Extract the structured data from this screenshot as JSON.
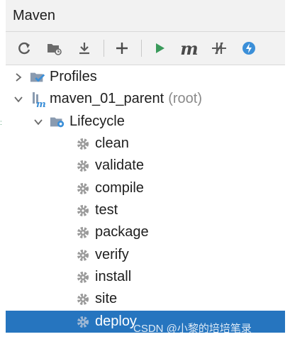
{
  "panel": {
    "title": "Maven"
  },
  "toolbar": {
    "buttons": [
      {
        "icon": "reload-icon"
      },
      {
        "icon": "generate-sources-icon"
      },
      {
        "icon": "download-icon"
      },
      {
        "icon": "add-icon"
      },
      {
        "icon": "run-icon"
      },
      {
        "icon": "execute-goal-icon",
        "label": "m"
      },
      {
        "icon": "skip-tests-icon"
      },
      {
        "icon": "offline-icon"
      }
    ]
  },
  "tree": {
    "profiles_label": "Profiles",
    "project_label": "maven_01_parent",
    "project_suffix": "(root)",
    "lifecycle_label": "Lifecycle",
    "goals": [
      "clean",
      "validate",
      "compile",
      "test",
      "package",
      "verify",
      "install",
      "site",
      "deploy"
    ],
    "selected_goal": "deploy"
  },
  "watermark": "CSDN @小黎的培培笔录",
  "colors": {
    "selection": "#2675bf",
    "run_green": "#3a9a5b",
    "folder_blue": "#4a8fd6",
    "gear_gray": "#9a9a9a"
  }
}
